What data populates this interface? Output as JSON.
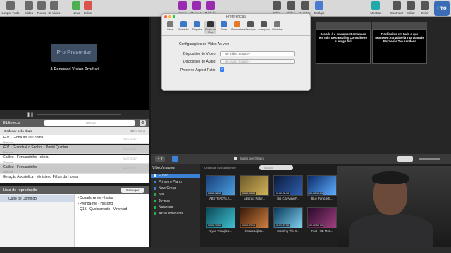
{
  "toolbar": {
    "items": [
      "Limpar Tudo",
      "Slides",
      "Fundo",
      "Bl Vídeo",
      "Novo",
      "Editor",
      "Alterar",
      "Mascara",
      "Módulos",
      "Edita",
      "Vídeo",
      "Mostrar",
      "Estágio",
      "Mostrar",
      "Controlar",
      "Editar",
      "Exibir"
    ]
  },
  "preview": {
    "logo": "Pro Presenter",
    "tagline": "A Renewed Vision Product"
  },
  "library": {
    "title": "Biblioteca",
    "search_placeholder": "Buscar",
    "sort_label": "Ordenar pelo título",
    "count": "1074 Itens",
    "rows": [
      {
        "title": "G02 - Glória ao Teu nome",
        "date": "25/07/2017",
        "sub": "Músicas"
      },
      {
        "title": "G07 - Grande é o Senhor - David Quinlan",
        "date": "25/07/2017",
        "sub": "Músicas"
      },
      {
        "title": "Galileu - Fernandinho - cópia",
        "date": "25/07/2017",
        "sub": "Músicas"
      },
      {
        "title": "Galileu - Fernandinho",
        "date": "30/07/2017",
        "sub": "Músicas"
      },
      {
        "title": "Geração Apostólica - Ministério Filhos da Honra",
        "date": "",
        "sub": ""
      }
    ]
  },
  "playlist": {
    "title": "Lista de reprodução",
    "button": "Conjugar",
    "left_items": [
      "Culto de Domingo"
    ],
    "right_items": [
      "Ousado Amor - Isaias",
      "Prenda-me - Hillsong",
      "Q15 - Quebrantado - Vineyard"
    ]
  },
  "slides": [
    {
      "text": "",
      "label": ""
    },
    {
      "text": "",
      "label": ""
    },
    {
      "text": "",
      "label": ""
    },
    {
      "text": "Grande é o seu amor Derramado em mim pelo Espírito Consolheiro e amigo fiel",
      "label": ""
    },
    {
      "text": "Fidelíssimo em tudo o que prometeu Agradável à Tua vontade Eterna é a Tua bondade",
      "label": ""
    }
  ],
  "dialog": {
    "title": "Preferências",
    "tabs": [
      "Geral",
      "Exibição",
      "Etiqueta",
      "Vídeo ao Vivo",
      "Rede",
      "Sincronizar",
      "Serviços",
      "Avançado",
      "Módulos"
    ],
    "section": "Configurações de Vídeo Ao vivo",
    "video_label": "Dispositivo de Vídeo:",
    "video_value": "- No Video Source -",
    "audio_label": "Dispositivo de Áudio:",
    "audio_value": "- No Audio Source -",
    "aspect_label": "Preserve Aspect Ratio:"
  },
  "mid": {
    "grid_label": "Slides por Grupo"
  },
  "media": {
    "header": "Vídeo/Imagem",
    "sort": "Ordenar manualmente",
    "search_placeholder": "Buscar",
    "groups": [
      "Fundo",
      "Primeiro Plano",
      "New Group",
      "Still",
      "Jovens",
      "Natureza",
      "Azul Dominante"
    ],
    "thumbs": [
      {
        "time": "00:00:18.13",
        "label": "ABSTRACT LA..."
      },
      {
        "time": "00:00:20.00",
        "label": "Abstract Natur..."
      },
      {
        "time": "00:00:22.13",
        "label": "Big City View F..."
      },
      {
        "time": "00:00:10.01",
        "label": "Blue Particle B..."
      },
      {
        "time": "00:00:20.00",
        "label": "Cyan Triangles..."
      },
      {
        "time": "00:00:23.15",
        "label": "Distant Lights..."
      },
      {
        "time": "00:01:23.05",
        "label": "Entering The S..."
      },
      {
        "time": "00:00:50.00",
        "label": "Fast - HD Moti..."
      }
    ]
  },
  "colors": {
    "accent": "#2f7cf6",
    "slide_border": "#555555"
  }
}
